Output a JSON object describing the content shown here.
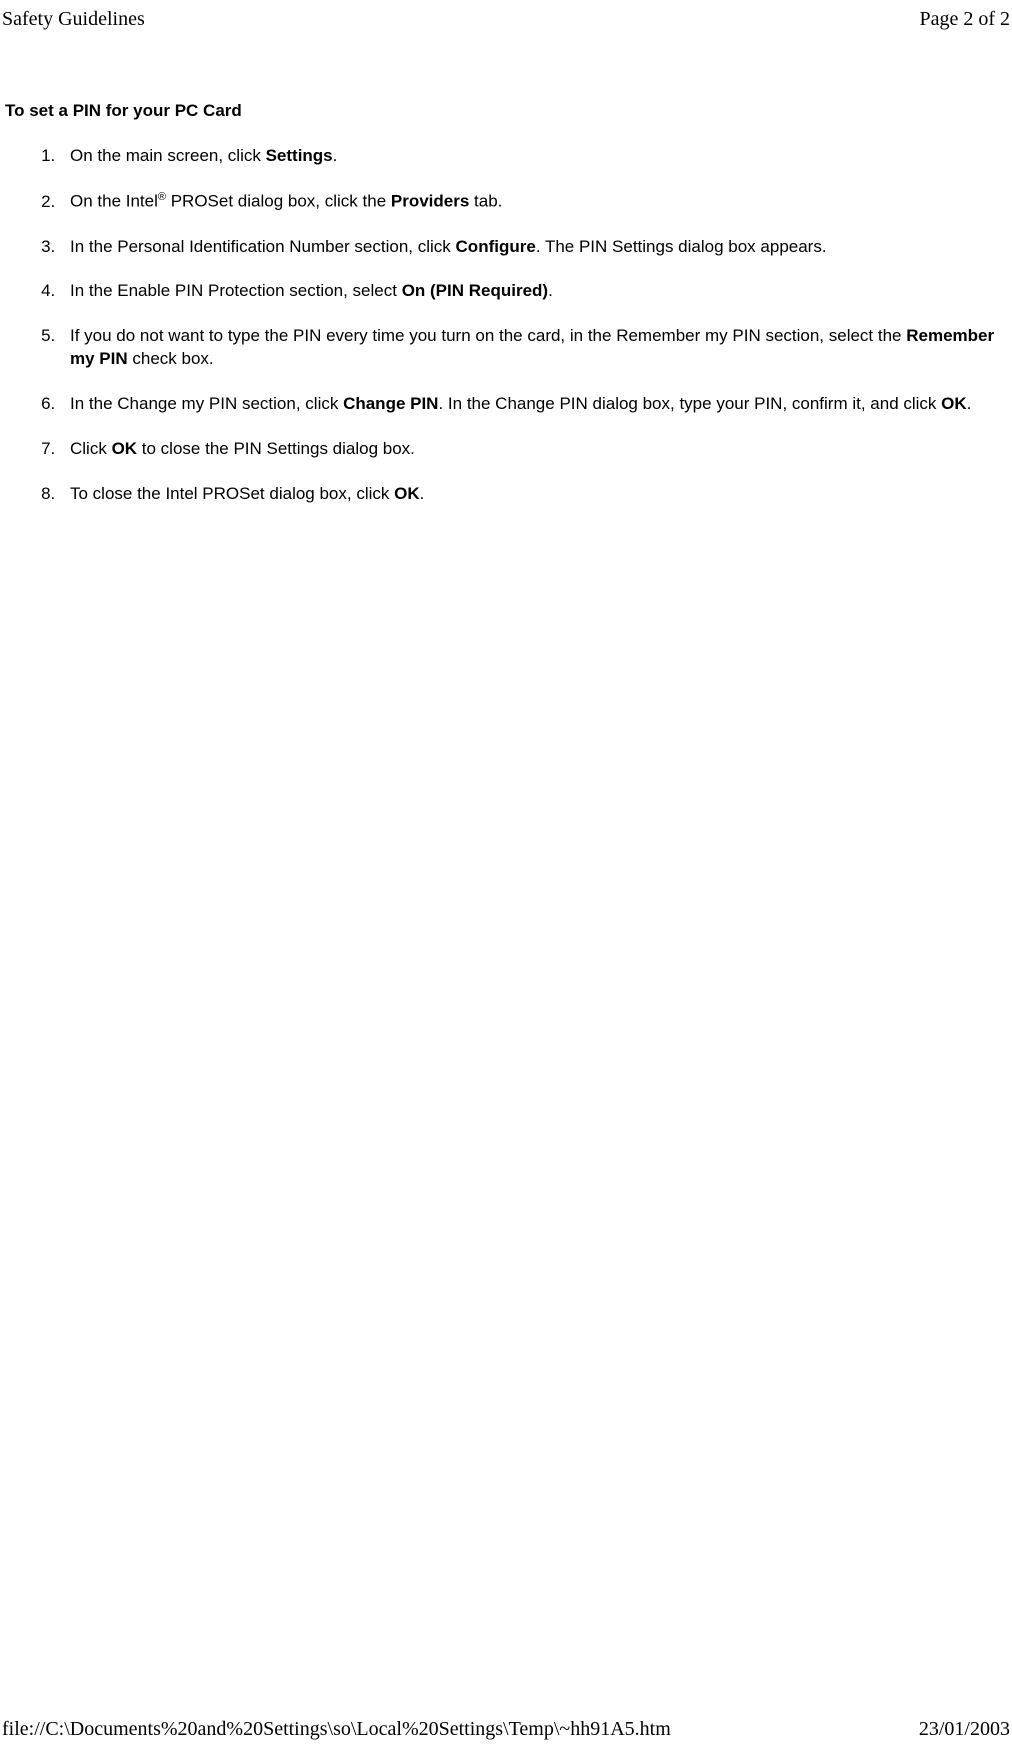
{
  "header": {
    "title": "Safety Guidelines",
    "pageinfo": "Page 2 of 2"
  },
  "content": {
    "heading": "To set a PIN for your PC Card",
    "steps": {
      "s1_a": "On the main screen, click ",
      "s1_b": "Settings",
      "s1_c": ".",
      "s2_a": "On the Intel",
      "s2_sup": "®",
      "s2_b": " PROSet dialog box, click the ",
      "s2_c": "Providers",
      "s2_d": " tab.",
      "s3_a": "In the Personal Identification Number section, click ",
      "s3_b": "Configure",
      "s3_c": ". The PIN Settings dialog box appears.",
      "s4_a": "In the Enable PIN Protection section, select ",
      "s4_b": "On (PIN Required)",
      "s4_c": ".",
      "s5_a": "If you do not want to type the PIN every time you turn on the card, in the Remember my PIN section, select the ",
      "s5_b": "Remember my PIN",
      "s5_c": " check box.",
      "s6_a": "In the Change my PIN section, click ",
      "s6_b": "Change PIN",
      "s6_c": ". In the Change PIN dialog box, type your PIN, confirm it, and click ",
      "s6_d": "OK",
      "s6_e": ".",
      "s7_a": "Click ",
      "s7_b": "OK",
      "s7_c": " to close the PIN Settings dialog box.",
      "s8_a": "To close the Intel PROSet dialog box, click ",
      "s8_b": "OK",
      "s8_c": "."
    }
  },
  "footer": {
    "path": "file://C:\\Documents%20and%20Settings\\so\\Local%20Settings\\Temp\\~hh91A5.htm",
    "date": "23/01/2003"
  }
}
